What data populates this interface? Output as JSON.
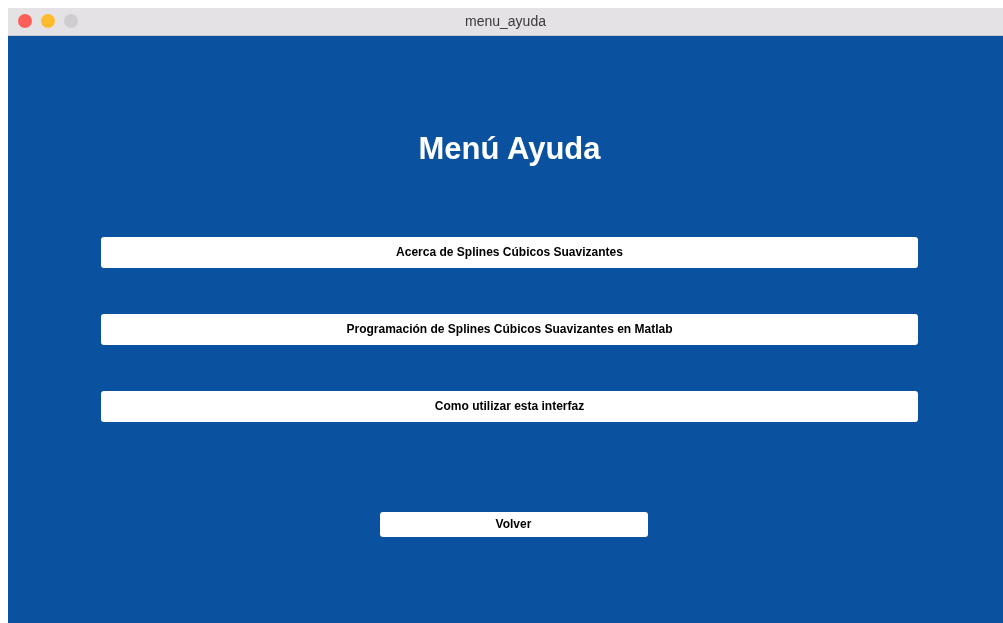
{
  "window": {
    "title": "menu_ayuda",
    "controls": [
      {
        "kind": "close",
        "disabled": false
      },
      {
        "kind": "minimize",
        "disabled": false
      },
      {
        "kind": "zoom",
        "disabled": true
      }
    ]
  },
  "heading": "Menú Ayuda",
  "menu_buttons": [
    {
      "label": "Acerca de Splines Cúbicos Suavizantes"
    },
    {
      "label": "Programación de Splines Cúbicos Suavizantes en Matlab"
    },
    {
      "label": "Como utilizar esta interfaz"
    }
  ],
  "back_button": {
    "label": "Volver"
  }
}
